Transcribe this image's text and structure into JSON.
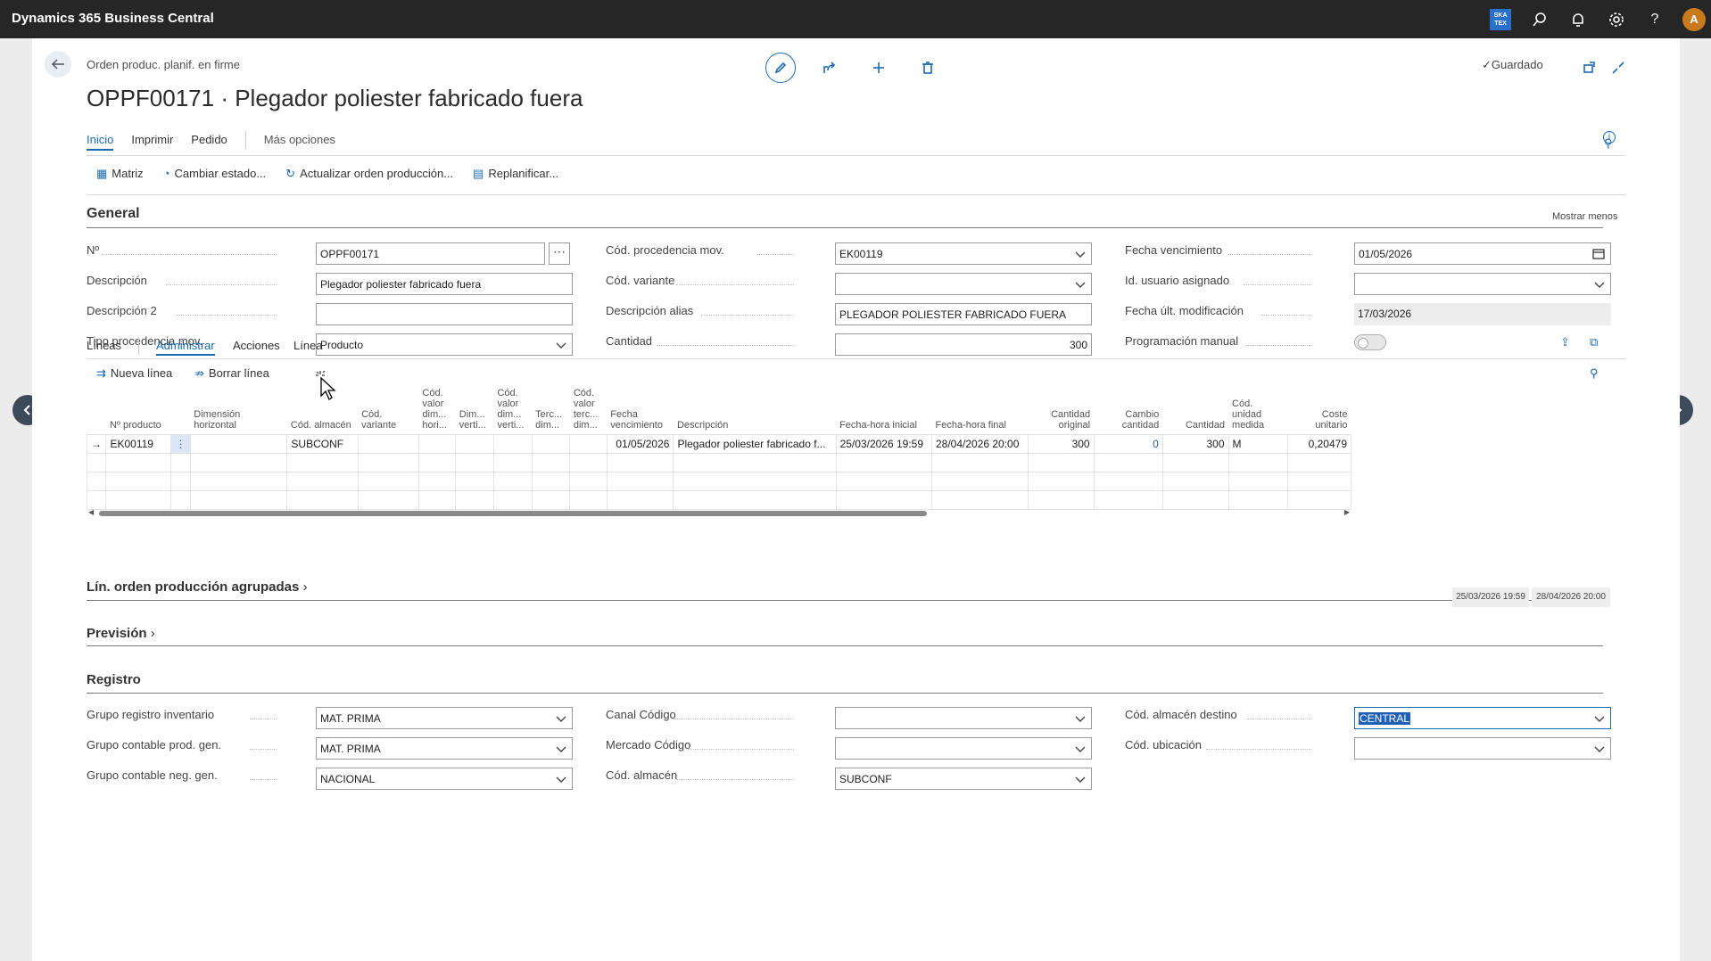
{
  "app": {
    "name": "Dynamics 365 Business Central",
    "badge": "SKA TEX",
    "avatar": "A"
  },
  "header": {
    "breadcrumb": "Orden produc. planif. en firme",
    "title": "OPPF00171 · Plegador poliester fabricado fuera",
    "status": "Guardado"
  },
  "menu": {
    "tabs": [
      "Inicio",
      "Imprimir",
      "Pedido",
      "Más opciones"
    ]
  },
  "actions": [
    "Matriz",
    "Cambiar estado...",
    "Actualizar orden producción...",
    "Replanificar..."
  ],
  "general": {
    "title": "General",
    "toggle_label": "Mostrar menos",
    "fields": {
      "no": {
        "label": "Nº",
        "value": "OPPF00171"
      },
      "descripcion": {
        "label": "Descripción",
        "value": "Plegador poliester fabricado fuera"
      },
      "descripcion2": {
        "label": "Descripción 2",
        "value": ""
      },
      "tipo_proc": {
        "label": "Tipo procedencia mov.",
        "value": "Producto"
      },
      "cod_proc": {
        "label": "Cód. procedencia mov.",
        "value": "EK00119"
      },
      "cod_variante": {
        "label": "Cód. variante",
        "value": ""
      },
      "desc_alias": {
        "label": "Descripción alias",
        "value": "PLEGADOR POLIESTER FABRICADO FUERA"
      },
      "cantidad": {
        "label": "Cantidad",
        "value": "300"
      },
      "fecha_venc": {
        "label": "Fecha vencimiento",
        "value": "01/05/2026"
      },
      "id_usuario": {
        "label": "Id. usuario asignado",
        "value": ""
      },
      "fecha_mod": {
        "label": "Fecha últ. modificación",
        "value": "17/03/2026"
      },
      "prog_manual": {
        "label": "Programación manual",
        "value": false
      }
    }
  },
  "lines": {
    "tabs": [
      "Líneas",
      "Administrar",
      "Acciones",
      "Línea"
    ],
    "actions": [
      "Nueva línea",
      "Borrar línea"
    ],
    "columns": [
      "Nº producto",
      "Dimensión horizontal",
      "Cód. almacén",
      "Cód. variante",
      "Cód. valor dim... hori...",
      "Dim... verti...",
      "Cód. valor dim... verti...",
      "Terc... dim...",
      "Cód. valor terc... dim...",
      "Fecha vencimiento",
      "Descripción",
      "Fecha-hora inicial",
      "Fecha-hora final",
      "Cantidad original",
      "Cambio cantidad",
      "Cantidad",
      "Cód. unidad medida",
      "Coste unitario"
    ],
    "rows": [
      [
        "EK00119",
        "",
        "SUBCONF",
        "",
        "",
        "",
        "",
        "",
        "",
        "01/05/2026",
        "Plegador poliester fabricado f...",
        "25/03/2026 19:59",
        "28/04/2026 20:00",
        "300",
        "0",
        "300",
        "M",
        "0,20479"
      ]
    ]
  },
  "grouped": {
    "title": "Lín. orden producción agrupadas"
  },
  "prevision": {
    "title": "Previsión",
    "start": "25/03/2026 19:59",
    "end": "28/04/2026 20:00"
  },
  "registro": {
    "title": "Registro",
    "fields": {
      "grupo_inv": {
        "label": "Grupo registro inventario",
        "value": "MAT. PRIMA"
      },
      "grupo_prod": {
        "label": "Grupo contable prod. gen.",
        "value": "MAT. PRIMA"
      },
      "grupo_neg": {
        "label": "Grupo contable neg. gen.",
        "value": "NACIONAL"
      },
      "canal": {
        "label": "Canal Código",
        "value": ""
      },
      "mercado": {
        "label": "Mercado Código",
        "value": ""
      },
      "cod_almacen": {
        "label": "Cód. almacén",
        "value": "SUBCONF"
      },
      "almacen_dest": {
        "label": "Cód. almacén destino",
        "value": "CENTRAL"
      },
      "ubicacion": {
        "label": "Cód. ubicación",
        "value": ""
      }
    }
  }
}
